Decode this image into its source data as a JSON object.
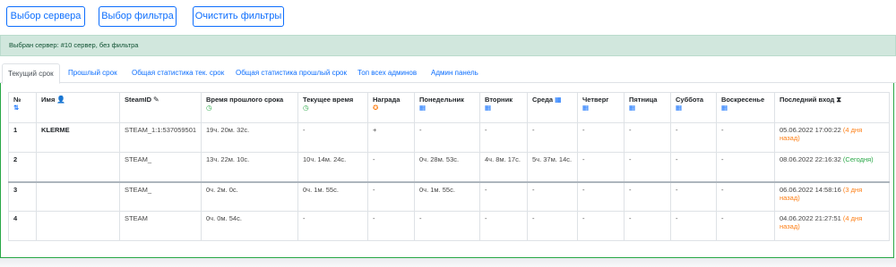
{
  "toolbar": {
    "server_button": "Выбор сервера",
    "filter_button": "Выбор фильтра",
    "clear_button": "Очистить фильтры"
  },
  "alert": {
    "text": "Выбран сервер: #10 сервер, без фильтра"
  },
  "tabs": [
    {
      "label": "Текущий срок"
    },
    {
      "label": "Прошлый срок"
    },
    {
      "label": "Общая статистика тек. срок"
    },
    {
      "label": "Общая статистика прошлый срок"
    },
    {
      "label": "Топ всех админов"
    },
    {
      "label": "Админ панель"
    }
  ],
  "table": {
    "headers": [
      "№",
      "Имя",
      "SteamID",
      "Время прошлого срока",
      "Текущее время",
      "Награда",
      "Понедельник",
      "Вторник",
      "Среда",
      "Четверг",
      "Пятница",
      "Суббота",
      "Воскресенье",
      "Последний вход"
    ],
    "rows": [
      {
        "num": "1",
        "name": "KLERME",
        "steamid": "STEAM_1:1:537059501",
        "prev": "19ч. 20м. 32с.",
        "cur": "-",
        "award": "+",
        "mon": "-",
        "tue": "-",
        "wed": "-",
        "thu": "-",
        "fri": "-",
        "sat": "-",
        "sun": "-",
        "last": "05.06.2022 17:00:22",
        "ago": "(4 дня назад)"
      },
      {
        "num": "2",
        "name": "",
        "steamid": "STEAM_",
        "prev": "13ч. 22м. 10с.",
        "cur": "10ч. 14м. 24с.",
        "award": "-",
        "mon": "0ч. 28м. 53с.",
        "tue": "4ч. 8м. 17с.",
        "wed": "5ч. 37м. 14с.",
        "thu": "-",
        "fri": "-",
        "sat": "-",
        "sun": "-",
        "last": "08.06.2022 22:16:32",
        "ago": "(Сегодня)"
      },
      {
        "num": "3",
        "name": "",
        "steamid": "STEAM_",
        "prev": "0ч. 2м. 0с.",
        "cur": "0ч. 1м. 55с.",
        "award": "-",
        "mon": "0ч. 1м. 55с.",
        "tue": "-",
        "wed": "-",
        "thu": "-",
        "fri": "-",
        "sat": "-",
        "sun": "-",
        "last": "06.06.2022 14:58:16",
        "ago": "(3 дня назад)"
      },
      {
        "num": "4",
        "name": "",
        "steamid": "STEAM",
        "prev": "0ч. 0м. 54с.",
        "cur": "-",
        "award": "-",
        "mon": "-",
        "tue": "-",
        "wed": "-",
        "thu": "-",
        "fri": "-",
        "sat": "-",
        "sun": "-",
        "last": "04.06.2022 21:27:51",
        "ago": "(4 дня назад)"
      }
    ]
  },
  "colors": {
    "primary": "#0d6efd",
    "success": "#28a745",
    "warning": "#fd7e14",
    "alert_bg": "#d1e7dd"
  },
  "icons": [
    "sort-icon",
    "user-icon",
    "wrench-icon",
    "clock-icon",
    "award-icon",
    "calendar-icon",
    "hourglass-icon"
  ]
}
